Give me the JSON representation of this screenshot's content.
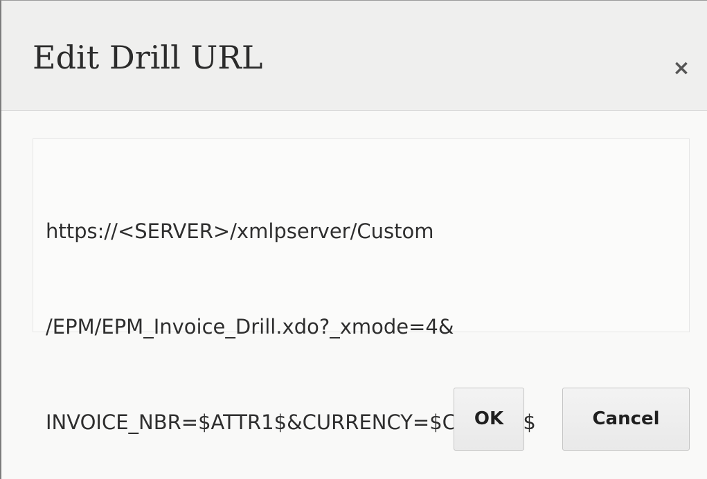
{
  "dialog": {
    "title": "Edit Drill URL",
    "close_icon": "close-icon",
    "close_glyph": "×"
  },
  "url_field": {
    "value": "https://<SERVER>/xmlpserver/Custom/EPM/EPM_Invoice_Drill.xdo?_xmode=4&INVOICE_NBR=$ATTR1$&CURRENCY=$CURKEY$",
    "lines": [
      "https://<SERVER>/xmlpserver/Custom",
      "/EPM/EPM_Invoice_Drill.xdo?_xmode=4&",
      "INVOICE_NBR=$ATTR1$&CURRENCY=$CURKEY$"
    ]
  },
  "buttons": {
    "ok_label": "OK",
    "cancel_label": "Cancel"
  }
}
